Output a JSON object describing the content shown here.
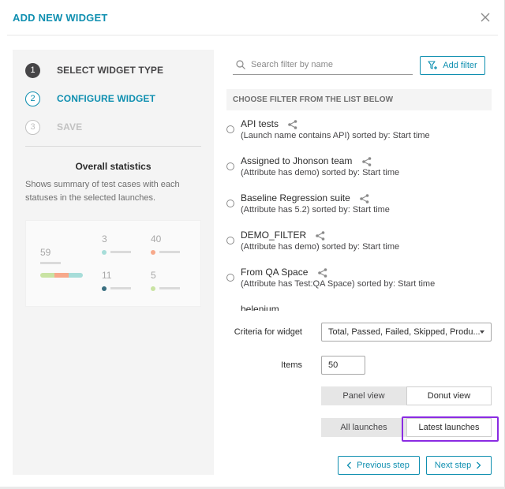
{
  "modal": {
    "title": "ADD NEW WIDGET"
  },
  "steps": [
    {
      "number": "1",
      "label": "SELECT WIDGET TYPE",
      "state": "done"
    },
    {
      "number": "2",
      "label": "CONFIGURE WIDGET",
      "state": "active"
    },
    {
      "number": "3",
      "label": "SAVE",
      "state": "disabled"
    }
  ],
  "widget": {
    "name": "Overall statistics",
    "description": "Shows summary of test cases with each statuses in the selected launches."
  },
  "preview": {
    "total": "59",
    "passed": "3",
    "failed": "40",
    "skipped": "11",
    "product_bug": "5"
  },
  "search": {
    "placeholder": "Search filter by name",
    "value": ""
  },
  "add_filter_label": "Add filter",
  "list_header": "CHOOSE FILTER FROM THE LIST BELOW",
  "filters": [
    {
      "name": "API tests",
      "description": "(Launch name contains API) sorted by: Start time"
    },
    {
      "name": "Assigned to Jhonson team",
      "description": "(Attribute has demo) sorted by: Start time"
    },
    {
      "name": "Baseline Regression suite",
      "description": "(Attribute has 5.2) sorted by: Start time"
    },
    {
      "name": "DEMO_FILTER",
      "description": "(Attribute has demo) sorted by: Start time"
    },
    {
      "name": "From QA Space",
      "description": "(Attribute has Test:QA Space) sorted by: Start time"
    },
    {
      "name": "belenium",
      "description": ""
    }
  ],
  "form": {
    "criteria_label": "Criteria for widget",
    "criteria_value": "Total, Passed, Failed, Skipped, Produ...",
    "items_label": "Items",
    "items_value": "50",
    "view_panel": "Panel view",
    "view_donut": "Donut view",
    "launch_all": "All launches",
    "launch_latest": "Latest launches"
  },
  "nav": {
    "previous": "Previous step",
    "next": "Next step"
  },
  "colors": {
    "accent": "#0f8fb0",
    "passed": "#a7ddd9",
    "failed": "#f7a98b",
    "skipped": "#3a6f80",
    "product_bug": "#c9e3a3",
    "highlight": "#8a2be2"
  }
}
